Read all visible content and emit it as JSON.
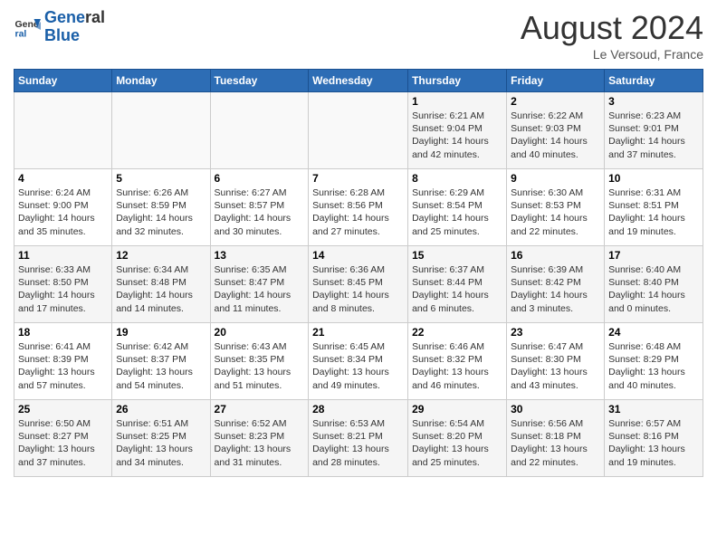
{
  "logo": {
    "line1": "General",
    "line2": "Blue"
  },
  "title": "August 2024",
  "location": "Le Versoud, France",
  "days_of_week": [
    "Sunday",
    "Monday",
    "Tuesday",
    "Wednesday",
    "Thursday",
    "Friday",
    "Saturday"
  ],
  "weeks": [
    [
      {
        "day": "",
        "info": ""
      },
      {
        "day": "",
        "info": ""
      },
      {
        "day": "",
        "info": ""
      },
      {
        "day": "",
        "info": ""
      },
      {
        "day": "1",
        "info": "Sunrise: 6:21 AM\nSunset: 9:04 PM\nDaylight: 14 hours and 42 minutes."
      },
      {
        "day": "2",
        "info": "Sunrise: 6:22 AM\nSunset: 9:03 PM\nDaylight: 14 hours and 40 minutes."
      },
      {
        "day": "3",
        "info": "Sunrise: 6:23 AM\nSunset: 9:01 PM\nDaylight: 14 hours and 37 minutes."
      }
    ],
    [
      {
        "day": "4",
        "info": "Sunrise: 6:24 AM\nSunset: 9:00 PM\nDaylight: 14 hours and 35 minutes."
      },
      {
        "day": "5",
        "info": "Sunrise: 6:26 AM\nSunset: 8:59 PM\nDaylight: 14 hours and 32 minutes."
      },
      {
        "day": "6",
        "info": "Sunrise: 6:27 AM\nSunset: 8:57 PM\nDaylight: 14 hours and 30 minutes."
      },
      {
        "day": "7",
        "info": "Sunrise: 6:28 AM\nSunset: 8:56 PM\nDaylight: 14 hours and 27 minutes."
      },
      {
        "day": "8",
        "info": "Sunrise: 6:29 AM\nSunset: 8:54 PM\nDaylight: 14 hours and 25 minutes."
      },
      {
        "day": "9",
        "info": "Sunrise: 6:30 AM\nSunset: 8:53 PM\nDaylight: 14 hours and 22 minutes."
      },
      {
        "day": "10",
        "info": "Sunrise: 6:31 AM\nSunset: 8:51 PM\nDaylight: 14 hours and 19 minutes."
      }
    ],
    [
      {
        "day": "11",
        "info": "Sunrise: 6:33 AM\nSunset: 8:50 PM\nDaylight: 14 hours and 17 minutes."
      },
      {
        "day": "12",
        "info": "Sunrise: 6:34 AM\nSunset: 8:48 PM\nDaylight: 14 hours and 14 minutes."
      },
      {
        "day": "13",
        "info": "Sunrise: 6:35 AM\nSunset: 8:47 PM\nDaylight: 14 hours and 11 minutes."
      },
      {
        "day": "14",
        "info": "Sunrise: 6:36 AM\nSunset: 8:45 PM\nDaylight: 14 hours and 8 minutes."
      },
      {
        "day": "15",
        "info": "Sunrise: 6:37 AM\nSunset: 8:44 PM\nDaylight: 14 hours and 6 minutes."
      },
      {
        "day": "16",
        "info": "Sunrise: 6:39 AM\nSunset: 8:42 PM\nDaylight: 14 hours and 3 minutes."
      },
      {
        "day": "17",
        "info": "Sunrise: 6:40 AM\nSunset: 8:40 PM\nDaylight: 14 hours and 0 minutes."
      }
    ],
    [
      {
        "day": "18",
        "info": "Sunrise: 6:41 AM\nSunset: 8:39 PM\nDaylight: 13 hours and 57 minutes."
      },
      {
        "day": "19",
        "info": "Sunrise: 6:42 AM\nSunset: 8:37 PM\nDaylight: 13 hours and 54 minutes."
      },
      {
        "day": "20",
        "info": "Sunrise: 6:43 AM\nSunset: 8:35 PM\nDaylight: 13 hours and 51 minutes."
      },
      {
        "day": "21",
        "info": "Sunrise: 6:45 AM\nSunset: 8:34 PM\nDaylight: 13 hours and 49 minutes."
      },
      {
        "day": "22",
        "info": "Sunrise: 6:46 AM\nSunset: 8:32 PM\nDaylight: 13 hours and 46 minutes."
      },
      {
        "day": "23",
        "info": "Sunrise: 6:47 AM\nSunset: 8:30 PM\nDaylight: 13 hours and 43 minutes."
      },
      {
        "day": "24",
        "info": "Sunrise: 6:48 AM\nSunset: 8:29 PM\nDaylight: 13 hours and 40 minutes."
      }
    ],
    [
      {
        "day": "25",
        "info": "Sunrise: 6:50 AM\nSunset: 8:27 PM\nDaylight: 13 hours and 37 minutes."
      },
      {
        "day": "26",
        "info": "Sunrise: 6:51 AM\nSunset: 8:25 PM\nDaylight: 13 hours and 34 minutes."
      },
      {
        "day": "27",
        "info": "Sunrise: 6:52 AM\nSunset: 8:23 PM\nDaylight: 13 hours and 31 minutes."
      },
      {
        "day": "28",
        "info": "Sunrise: 6:53 AM\nSunset: 8:21 PM\nDaylight: 13 hours and 28 minutes."
      },
      {
        "day": "29",
        "info": "Sunrise: 6:54 AM\nSunset: 8:20 PM\nDaylight: 13 hours and 25 minutes."
      },
      {
        "day": "30",
        "info": "Sunrise: 6:56 AM\nSunset: 8:18 PM\nDaylight: 13 hours and 22 minutes."
      },
      {
        "day": "31",
        "info": "Sunrise: 6:57 AM\nSunset: 8:16 PM\nDaylight: 13 hours and 19 minutes."
      }
    ]
  ]
}
